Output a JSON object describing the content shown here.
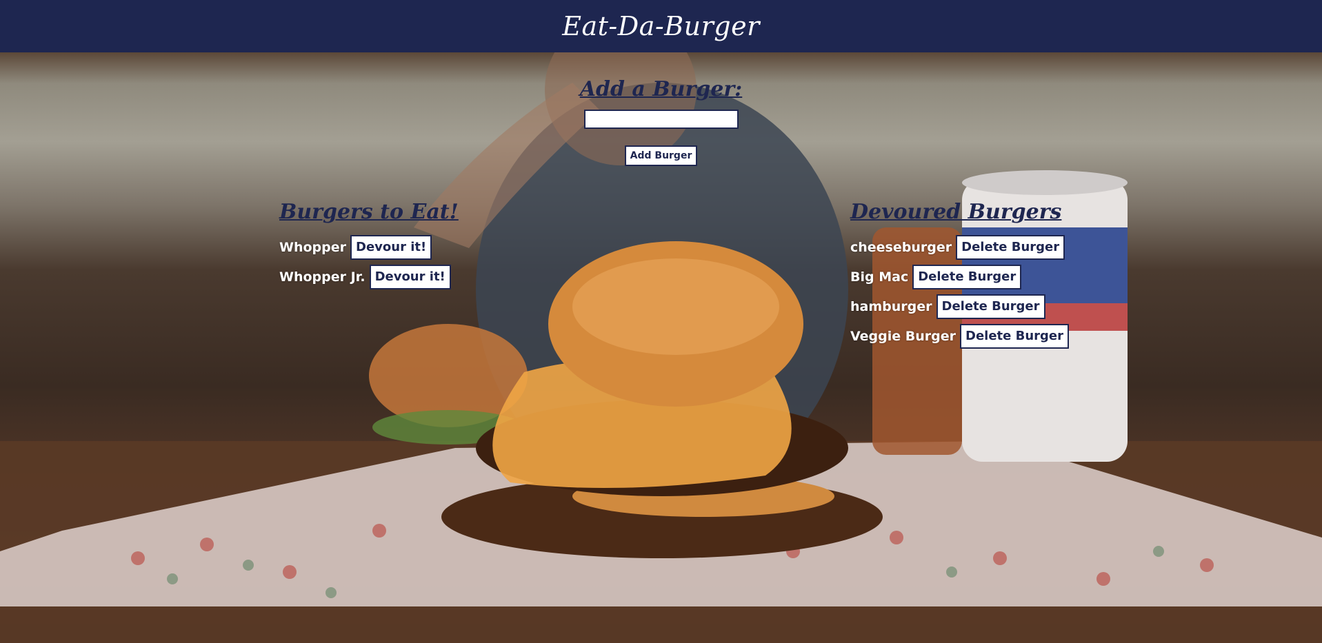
{
  "header": {
    "title": "Eat-Da-Burger"
  },
  "add_form": {
    "heading": "Add a Burger:",
    "input_value": "",
    "button_label": "Add Burger"
  },
  "to_eat": {
    "heading": "Burgers to Eat!",
    "items": [
      {
        "name": "Whopper",
        "button_label": "Devour it!"
      },
      {
        "name": "Whopper Jr.",
        "button_label": "Devour it!"
      }
    ]
  },
  "devoured": {
    "heading": "Devoured Burgers",
    "items": [
      {
        "name": "cheeseburger",
        "button_label": "Delete Burger"
      },
      {
        "name": "Big Mac",
        "button_label": "Delete Burger"
      },
      {
        "name": "hamburger",
        "button_label": "Delete Burger"
      },
      {
        "name": "Veggie Burger",
        "button_label": "Delete Burger"
      }
    ]
  },
  "colors": {
    "navy": "#1e2650",
    "white": "#ffffff"
  }
}
